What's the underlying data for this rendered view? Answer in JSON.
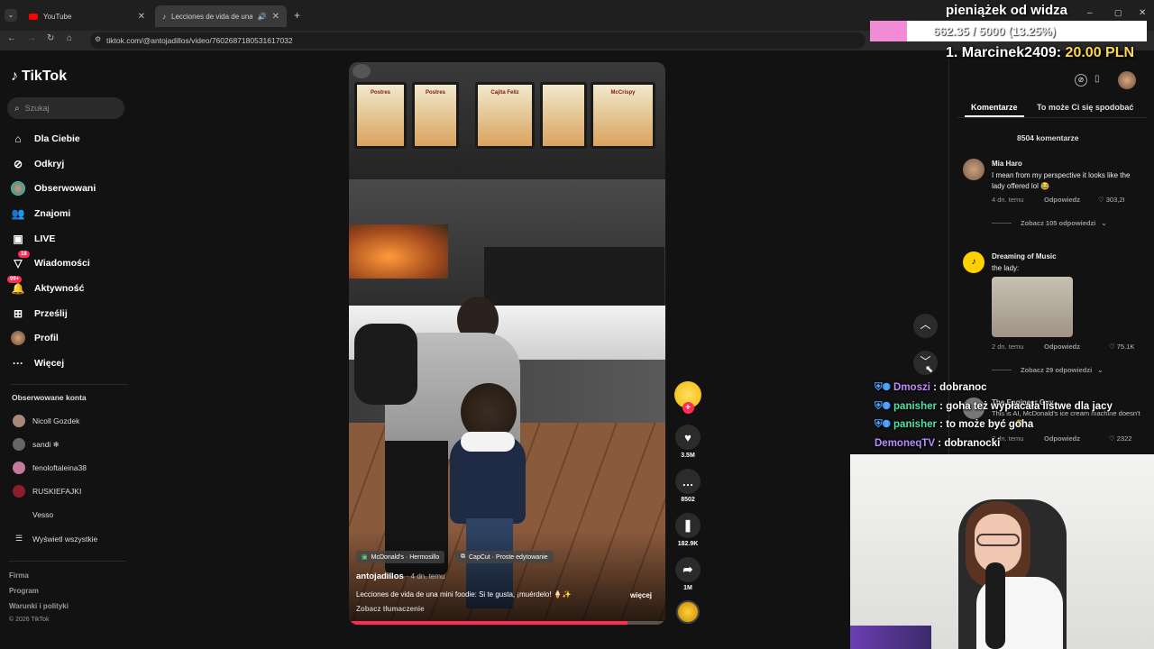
{
  "browser": {
    "tabs": [
      {
        "label": "YouTube"
      },
      {
        "label": "Lecciones de vida de una mi"
      }
    ],
    "url": "tiktok.com/@antojadillos/video/7602687180531617032"
  },
  "sidebar": {
    "logo": "TikTok",
    "search_placeholder": "Szukaj",
    "nav": [
      {
        "label": "Dla Ciebie",
        "icon": "home-icon"
      },
      {
        "label": "Odkryj",
        "icon": "compass-icon"
      },
      {
        "label": "Obserwowani",
        "icon": "avatar-icon"
      },
      {
        "label": "Znajomi",
        "icon": "friends-icon"
      },
      {
        "label": "LIVE",
        "icon": "live-icon"
      },
      {
        "label": "Wiadomości",
        "icon": "send-icon",
        "badge": "18"
      },
      {
        "label": "Aktywność",
        "icon": "bell-icon",
        "badge": "99+"
      },
      {
        "label": "Prześlij",
        "icon": "upload-icon"
      },
      {
        "label": "Profil",
        "icon": "profile-icon"
      },
      {
        "label": "Więcej",
        "icon": "more-icon"
      }
    ],
    "followed_heading": "Obserwowane konta",
    "followed": [
      {
        "name": "Nicoll Gozdek"
      },
      {
        "name": "sandi ❄"
      },
      {
        "name": "fenoloftaleina38"
      },
      {
        "name": "RUSKIEFAJKI"
      },
      {
        "name": "Vesso"
      }
    ],
    "show_all": "Wyświetl wszystkie",
    "footer": [
      "Firma",
      "Program",
      "Warunki i polityki",
      "© 2026 TikTok"
    ]
  },
  "video": {
    "menu_boards": [
      "Postres",
      "Postres",
      "Cajita Feliz",
      "",
      "McCrispy"
    ],
    "tags": [
      {
        "label": "McDonald's · Hermosillo"
      },
      {
        "label": "CapCut · Proste edytowanie"
      }
    ],
    "author": "antojadillos",
    "time": "· 4 dn. temu",
    "caption": "Lecciones de vida de una mini foodie: Si te gusta, ¡muérdelo! 🍦✨",
    "more": "więcej",
    "translate": "Zobacz tłumaczenie",
    "progress": 0.88
  },
  "actions": {
    "likes": "3.5M",
    "comments": "8502",
    "saves": "182.9K",
    "shares": "1M"
  },
  "comments_panel": {
    "tab_comments": "Komentarze",
    "tab_recommended": "To może Ci się spodobać",
    "count": "8504 komentarze",
    "items": [
      {
        "author": "Mia Haro",
        "text": "I mean from my perspective it looks like the lady offered lol 😂",
        "time": "4 dn. temu",
        "reply": "Odpowiedz",
        "likes": "303,2I",
        "view_replies": "Zobacz 105 odpowiedzi"
      },
      {
        "author": "Dreaming of Music",
        "text": "the lady:",
        "time": "2 dn. temu",
        "reply": "Odpowiedz",
        "likes": "75.1K",
        "view_replies": "Zobacz 29 odpowiedzi"
      },
      {
        "author": "The Engineer Guy",
        "text": "This is AI, McDonald's ice cream machine doesn't work ... 😂",
        "time": "2 dn. temu",
        "reply": "Odpowiedz",
        "likes": "2322"
      }
    ]
  },
  "stream": {
    "donation_title": "pieniążek od widza",
    "donation_progress": "662.35 / 5000 (13.25%)",
    "donation_fraction": 0.1325,
    "top_donor_rank": "1.",
    "top_donor_name": "Marcinek2409:",
    "top_donor_amount": "20.00 PLN",
    "chat": [
      {
        "user": "Dmoszi",
        "msg": " : dobranoc",
        "color": "#c38bff"
      },
      {
        "user": "panisher",
        "msg": " : goha też wypłacała listwe dla jacy",
        "color": "#4de3a8"
      },
      {
        "user": "panisher",
        "msg": " : to może być goha",
        "color": "#4de3a8"
      },
      {
        "user": "DemoneqTV",
        "msg": " : dobranocki",
        "color": "#b98cff"
      }
    ]
  },
  "colors": {
    "tiktok_red": "#fe2c55",
    "donation_pink": "#f28bd6",
    "donor_yellow": "#ffd84a"
  }
}
